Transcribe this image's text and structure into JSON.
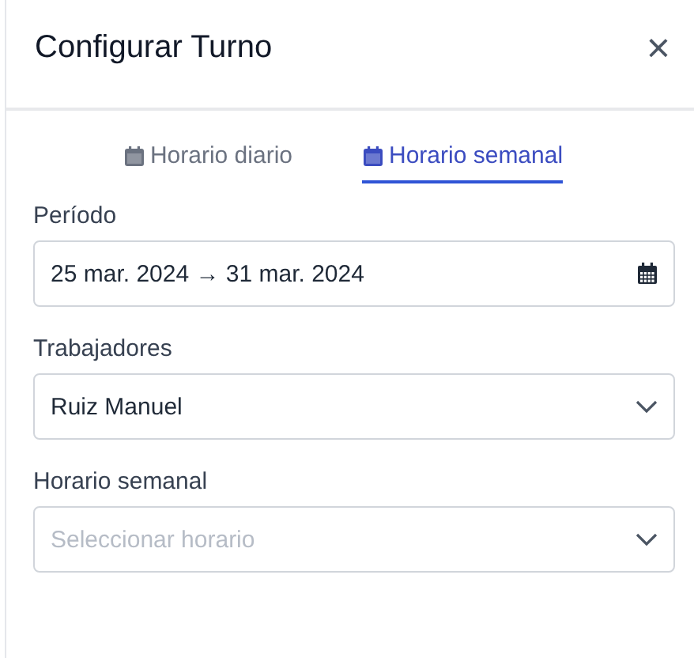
{
  "panel": {
    "title": "Configurar Turno",
    "close": "×"
  },
  "tabs": [
    {
      "label": "Horario diario",
      "selected": false
    },
    {
      "label": "Horario semanal",
      "selected": true
    }
  ],
  "fields": [
    {
      "kind": "date",
      "label": "Período",
      "value": "25 mar. 2024 → 31 mar. 2024"
    },
    {
      "kind": "select",
      "label": "Trabajadores",
      "value": "Ruiz Manuel"
    },
    {
      "kind": "select",
      "label": "Horario semanal",
      "placeholder": "Seleccionar horario"
    }
  ]
}
